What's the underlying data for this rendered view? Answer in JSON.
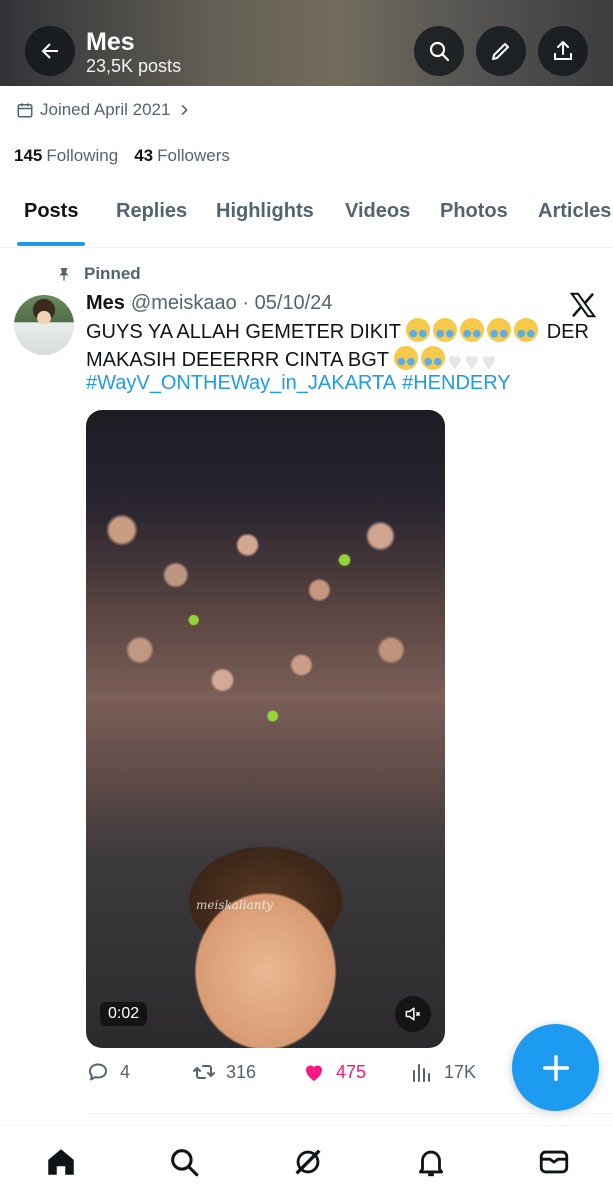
{
  "header": {
    "title": "Mes",
    "subtitle": "23,5K posts"
  },
  "profile": {
    "joined": "Joined April 2021",
    "following_count": "145",
    "following_label": "Following",
    "followers_count": "43",
    "followers_label": "Followers"
  },
  "tabs": [
    {
      "label": "Posts",
      "active": true
    },
    {
      "label": "Replies",
      "active": false
    },
    {
      "label": "Highlights",
      "active": false
    },
    {
      "label": "Videos",
      "active": false
    },
    {
      "label": "Photos",
      "active": false
    },
    {
      "label": "Articles",
      "active": false
    }
  ],
  "tweet": {
    "pinned_label": "Pinned",
    "name": "Mes",
    "handle_date": "@meiskaao · 05/10/24",
    "line1": "GUYS YA ALLAH GEMETER DIKIT",
    "line1_end": "DER",
    "line2": "MAKASIH DEEERRR CINTA BGT",
    "hashtag1": "#WayV_ONTHEWay_in_JAKARTA",
    "hashtag2": "#HENDERY",
    "media": {
      "watermark": "meiskalianty",
      "duration": "0:02"
    },
    "stats": {
      "replies": "4",
      "reposts": "316",
      "likes": "475",
      "views": "17K"
    }
  },
  "colors": {
    "accent": "#1d9bf0",
    "like": "#f91880",
    "text_secondary": "#536471"
  },
  "icons": [
    "back-arrow-icon",
    "search-icon",
    "pencil-icon",
    "share-icon",
    "calendar-icon",
    "chevron-right-icon",
    "pin-icon",
    "x-logo-icon",
    "crying-emoji-icon",
    "white-heart-icon",
    "mute-icon",
    "reply-icon",
    "repost-icon",
    "like-icon",
    "views-icon",
    "plus-icon",
    "home-icon",
    "grok-icon",
    "bell-icon",
    "mail-icon"
  ]
}
